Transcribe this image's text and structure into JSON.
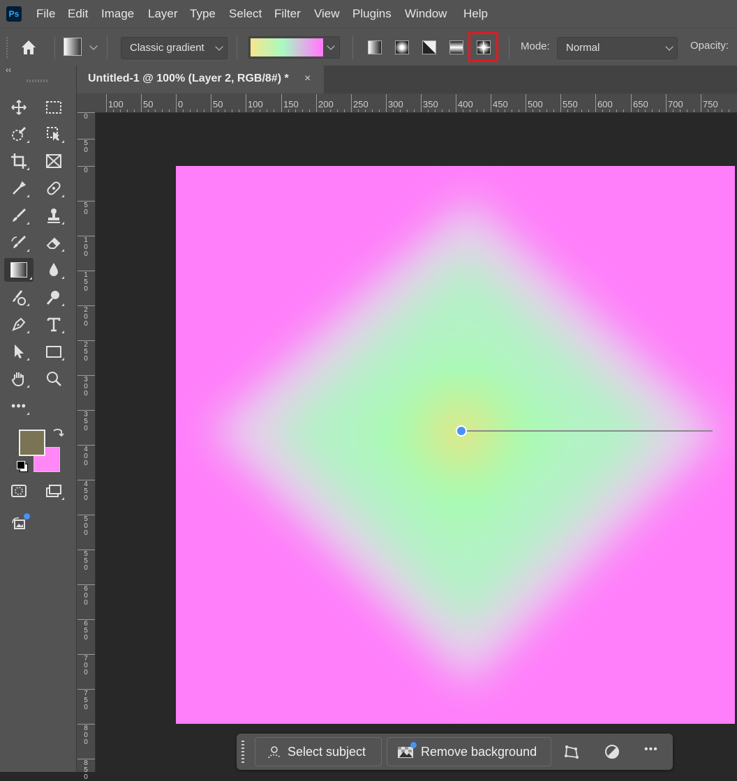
{
  "app": {
    "logo": "Ps"
  },
  "menu": [
    "File",
    "Edit",
    "Image",
    "Layer",
    "Type",
    "Select",
    "Filter",
    "View",
    "Plugins",
    "Window",
    "Help"
  ],
  "options": {
    "gradient_type": "Classic gradient",
    "gradient_colors": [
      "#f3e07a",
      "#a8f7c8",
      "#ff7ffa"
    ],
    "gradient_styles": [
      "linear-gradient",
      "radial-gradient",
      "angle-gradient",
      "reflected-gradient",
      "diamond-gradient"
    ],
    "selected_style": "diamond-gradient",
    "highlight_color": "#e5191e",
    "mode_label": "Mode:",
    "mode_value": "Normal",
    "opacity_label": "Opacity:"
  },
  "document": {
    "tab_title": "Untitled-1 @ 100% (Layer 2, RGB/8#) *",
    "close_glyph": "×"
  },
  "collapse_glyph": "‹‹",
  "ruler_top_labels": [
    "100",
    "50",
    "0",
    "50",
    "100",
    "150",
    "200",
    "250",
    "300",
    "350",
    "400",
    "450",
    "500",
    "550",
    "600",
    "650",
    "700",
    "750"
  ],
  "ruler_left_labels": [
    "0",
    "50",
    "0",
    "50",
    "100",
    "150",
    "200",
    "250",
    "300",
    "350",
    "400",
    "450",
    "500",
    "550",
    "600",
    "650",
    "700",
    "750",
    "800",
    "850"
  ],
  "colors": {
    "foreground": "#7a7455",
    "background": "#ff88f6",
    "canvas_outer": "#ff7ffa",
    "canvas_mid": "#a8f7c8",
    "canvas_center": "#f3e07a",
    "handle": "#4a90ff"
  },
  "context_bar": {
    "select_subject": "Select subject",
    "remove_background": "Remove background",
    "more_glyph": "•••"
  }
}
